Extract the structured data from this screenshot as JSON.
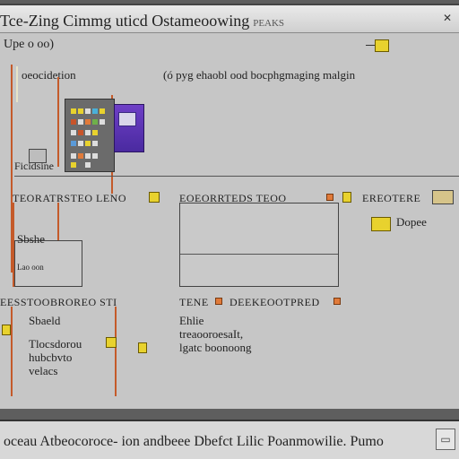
{
  "window": {
    "title": "Tce-Zing Cimmg uticd Ostameoowing",
    "title_suffix": "PEAKS",
    "close_icon": "close-icon"
  },
  "toolbar": {
    "field_label": "Upe o oo)"
  },
  "panels": {
    "left_heading": "oeocidetion",
    "right_heading": "(ó pyg ehaobl ood bocphgmaging malgin",
    "thumb_caption": "Ficidsine"
  },
  "row_headers": {
    "row1_a": "TEORATRSTEO LENO",
    "row1_b": "EOEORRTEDS TEOO",
    "row1_c": "EREOTERE",
    "row2_a": "EESSTOOBROREO STI",
    "row2_b": "TENE",
    "row2_c": "DEEKEOOTPRED"
  },
  "labels": {
    "box1_title": "Sbshe",
    "box1_sub": "Lao oon",
    "right_tag": "Dopee",
    "list_left": "Sbaeld",
    "list_left_2": "Tlocsdorou\nhubcbvto\nvelacs",
    "list_right": "Ehlie\ntreaooroesaIt,\nlgatc boonoong"
  },
  "statusbar": {
    "text": "oceau Atbeocoroce- ion andbeee Dbefct Lilic Poanmowilie. Pumo",
    "icon": "window-icon"
  },
  "colors": {
    "accent_yellow": "#e8d22e",
    "accent_orange": "#e07a3a",
    "accent_purple": "#5b34b3"
  }
}
